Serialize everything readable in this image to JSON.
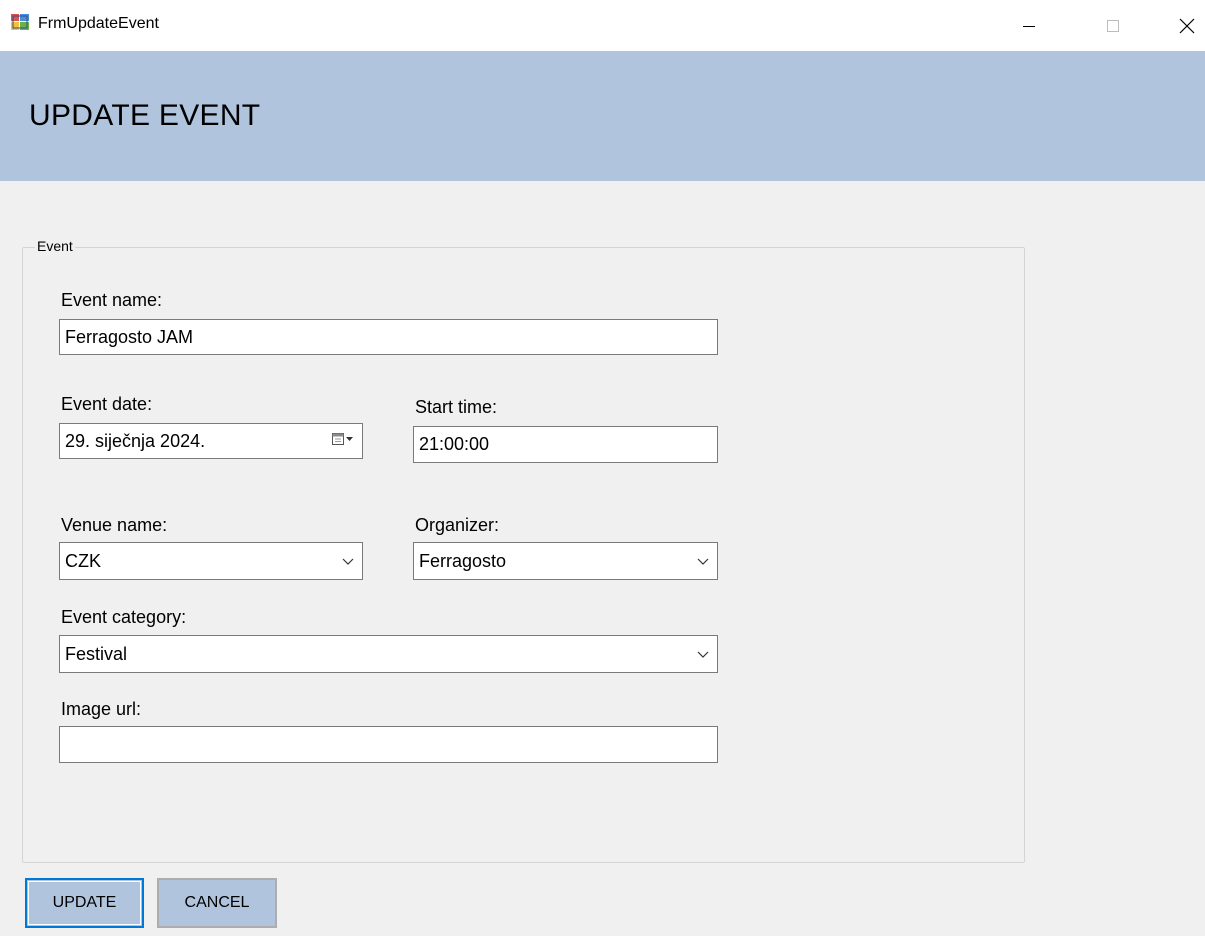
{
  "window": {
    "title": "FrmUpdateEvent"
  },
  "header": {
    "title": "UPDATE EVENT"
  },
  "group": {
    "legend": "Event"
  },
  "form": {
    "event_name": {
      "label": "Event name:",
      "value": "Ferragosto JAM"
    },
    "event_date": {
      "label": "Event date:",
      "value": "29.  siječnja  2024."
    },
    "start_time": {
      "label": "Start time:",
      "value": "21:00:00"
    },
    "venue_name": {
      "label": "Venue name:",
      "value": "CZK"
    },
    "organizer": {
      "label": "Organizer:",
      "value": "Ferragosto"
    },
    "event_category": {
      "label": "Event category:",
      "value": "Festival"
    },
    "image_url": {
      "label": "Image url:",
      "value": ""
    }
  },
  "buttons": {
    "update": "UPDATE",
    "cancel": "CANCEL"
  },
  "icons": {
    "app": "app-window-icon",
    "minimize": "minimize-icon",
    "maximize": "maximize-icon",
    "close": "close-icon",
    "calendar": "calendar-icon",
    "dropdown": "chevron-down-icon"
  },
  "colors": {
    "banner": "#b0c4de",
    "button": "#b0c4de",
    "focus_border": "#0078d7",
    "background": "#f0f0f0"
  }
}
